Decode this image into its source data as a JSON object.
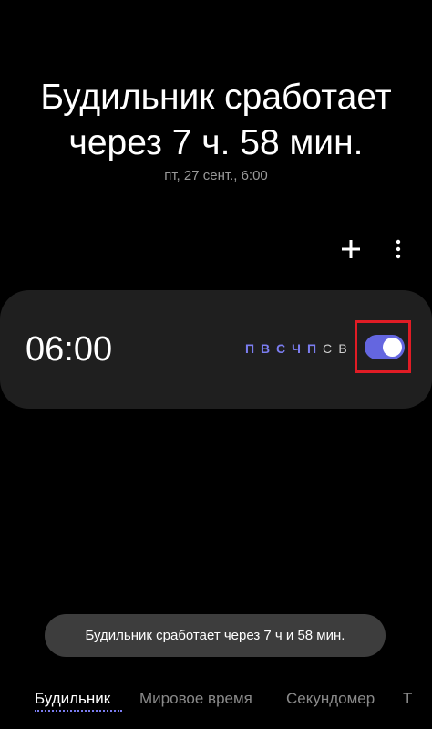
{
  "header": {
    "line1": "Будильник сработает",
    "line2": "через 7 ч. 58 мин.",
    "next_date": "пт, 27 сент., 6:00"
  },
  "toolbar": {
    "add_icon": "plus-icon",
    "more_icon": "more-vert-icon"
  },
  "alarm": {
    "time": "06:00",
    "days": [
      {
        "label": "П",
        "active": true
      },
      {
        "label": "В",
        "active": true
      },
      {
        "label": "С",
        "active": true
      },
      {
        "label": "Ч",
        "active": true
      },
      {
        "label": "П",
        "active": true
      },
      {
        "label": "С",
        "active": false
      },
      {
        "label": "В",
        "active": false
      }
    ],
    "enabled": true
  },
  "toast": {
    "text": "Будильник сработает через 7 ч и 58 мин."
  },
  "tabs": [
    {
      "label": "Будильник",
      "active": true
    },
    {
      "label": "Мировое время",
      "active": false
    },
    {
      "label": "Секундомер",
      "active": false
    },
    {
      "label": "Т",
      "active": false
    }
  ],
  "colors": {
    "background": "#000000",
    "card": "#1f1f1f",
    "accent": "#6466e0",
    "highlight": "#e01c25",
    "toast": "#3d3d3d"
  }
}
